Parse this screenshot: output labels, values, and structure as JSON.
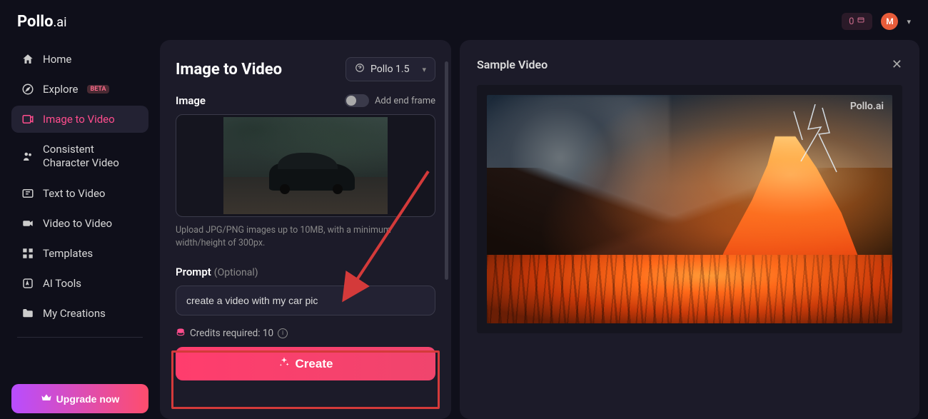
{
  "brand": {
    "name": "Pollo",
    "suffix": ".ai"
  },
  "topbar": {
    "credit_badge": "0",
    "avatar_letter": "M"
  },
  "sidebar": {
    "items": [
      {
        "label": "Home",
        "icon": "home"
      },
      {
        "label": "Explore",
        "icon": "compass",
        "badge": "BETA"
      },
      {
        "label": "Image to Video",
        "icon": "image-to-video",
        "active": true
      },
      {
        "label": "Consistent Character Video",
        "icon": "character"
      },
      {
        "label": "Text to Video",
        "icon": "text-to-video"
      },
      {
        "label": "Video to Video",
        "icon": "video-to-video"
      },
      {
        "label": "Templates",
        "icon": "templates"
      },
      {
        "label": "AI Tools",
        "icon": "ai-tools"
      },
      {
        "label": "My Creations",
        "icon": "folder"
      }
    ],
    "upgrade_label": "Upgrade now"
  },
  "editor": {
    "title": "Image to Video",
    "model_selected": "Pollo 1.5",
    "image_label": "Image",
    "end_frame_label": "Add end frame",
    "upload_hint": "Upload JPG/PNG images up to 10MB, with a minimum width/height of 300px.",
    "prompt_label": "Prompt",
    "prompt_optional": "(Optional)",
    "prompt_value": "create a video with my car pic",
    "credits_label": "Credits required: 10",
    "create_label": "Create"
  },
  "preview": {
    "title": "Sample Video",
    "watermark": "Pollo.ai"
  },
  "colors": {
    "accent": "#ff4d8d",
    "gradient_start": "#b84dff",
    "gradient_end": "#ff4d6d",
    "panel": "#1c1b29",
    "bg": "#0f0f1a"
  }
}
